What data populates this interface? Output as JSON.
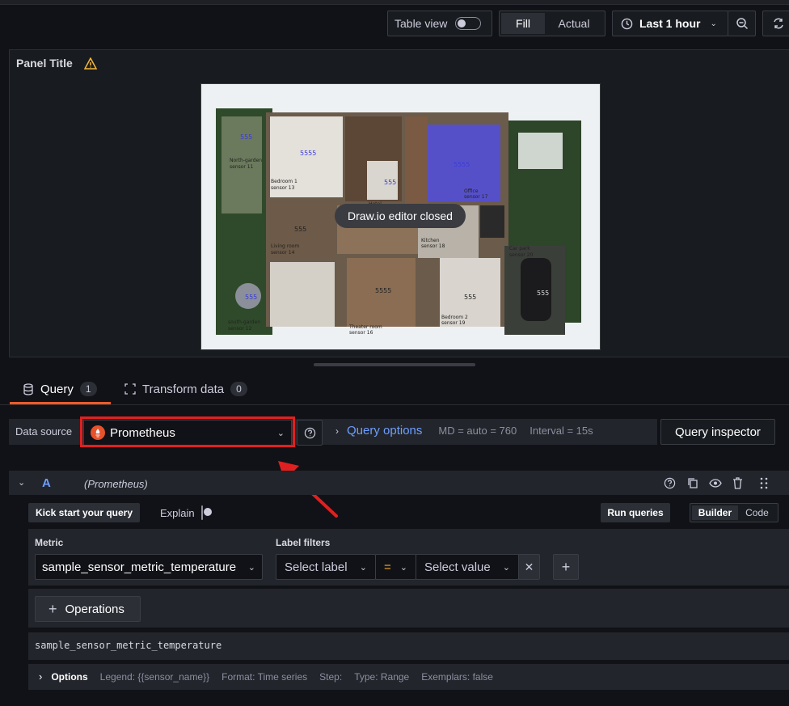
{
  "toolbar": {
    "table_view_label": "Table view",
    "fill_label": "Fill",
    "actual_label": "Actual",
    "time_range_label": "Last 1 hour"
  },
  "panel": {
    "title": "Panel Title",
    "toast": "Draw.io editor closed",
    "rooms": [
      {
        "name": "North-garden",
        "sensor": "sensor 11"
      },
      {
        "name": "Bedroom 1",
        "sensor": "sensor 13"
      },
      {
        "name": "Hotel",
        "sensor": "sensor 15"
      },
      {
        "name": "Office",
        "sensor": "sensor 17"
      },
      {
        "name": "Living room",
        "sensor": "sensor 14"
      },
      {
        "name": "Kitchen",
        "sensor": "sensor 18"
      },
      {
        "name": "Car park",
        "sensor": "sensor 20"
      },
      {
        "name": "south-garden",
        "sensor": "sensor 12"
      },
      {
        "name": "Theater room",
        "sensor": "sensor 16"
      },
      {
        "name": "Bedroom 2",
        "sensor": "sensor 19"
      }
    ],
    "values": [
      "555",
      "5555",
      "555",
      "5555",
      "555",
      "555",
      "555",
      "5555",
      "555",
      "555"
    ]
  },
  "tabs": {
    "query_label": "Query",
    "query_count": "1",
    "transform_label": "Transform data",
    "transform_count": "0"
  },
  "datasource": {
    "label": "Data source",
    "value": "Prometheus",
    "query_options_label": "Query options",
    "md_info": "MD = auto = 760",
    "interval_info": "Interval = 15s",
    "inspector_label": "Query inspector"
  },
  "query": {
    "ref_id": "A",
    "ds_name": "(Prometheus)",
    "kickstart_label": "Kick start your query",
    "explain_label": "Explain",
    "run_label": "Run queries",
    "builder_label": "Builder",
    "code_label": "Code",
    "metric_label": "Metric",
    "metric_value": "sample_sensor_metric_temperature",
    "label_filters_label": "Label filters",
    "select_label_placeholder": "Select label",
    "operator": "=",
    "select_value_placeholder": "Select value",
    "operations_label": "Operations",
    "preview": "sample_sensor_metric_temperature",
    "options_label": "Options",
    "legend": "Legend: {{sensor_name}}",
    "format": "Format: Time series",
    "step": "Step:",
    "type": "Type: Range",
    "exemplars": "Exemplars: false"
  },
  "colors": {
    "accent_blue": "#6e9fff",
    "highlight_red": "#e02020",
    "tab_orange": "#f05a28",
    "warning": "#f5b73b"
  }
}
